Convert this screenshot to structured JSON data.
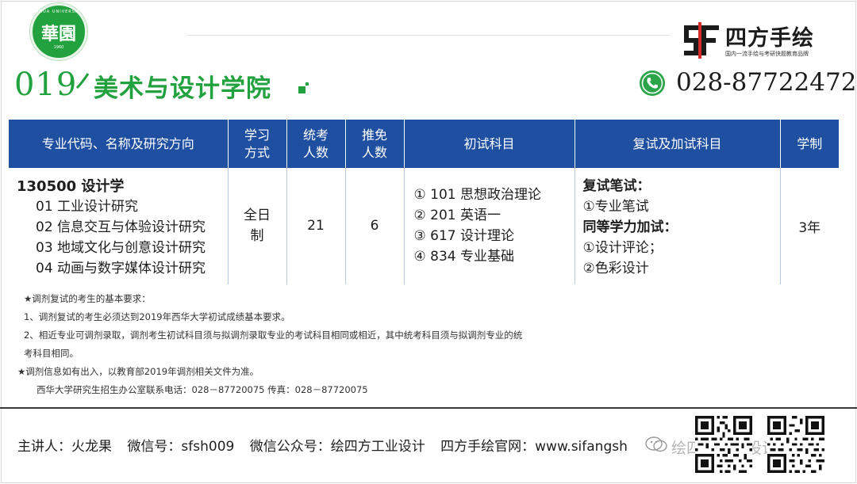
{
  "header": {
    "logo": {
      "main_text": "華園",
      "ring_text_top": "XIHUA UNIVERSITY",
      "ring_text_bottom": "1960"
    },
    "brand": {
      "name": "四方手绘",
      "slogan": "国内一流手绘与考研快题教育品牌",
      "mark_icon": "sf-logo-icon"
    },
    "school_code": "019",
    "school_name": "美术与设计学院",
    "phone_icon": "phone-icon",
    "phone": "028-87722472"
  },
  "table": {
    "headers": [
      "专业代码、名称及研究方向",
      "学习方式",
      "统考人数",
      "推免人数",
      "初试科目",
      "复试及加试科目",
      "学制"
    ],
    "headers_lines": [
      [
        "专业代码、名称及研究方向"
      ],
      [
        "学习",
        "方式"
      ],
      [
        "统考",
        "人数"
      ],
      [
        "推免",
        "人数"
      ],
      [
        "初试科目"
      ],
      [
        "复试及加试科目"
      ],
      [
        "学制"
      ]
    ],
    "row": {
      "major": "130500 设计学",
      "directions": [
        "01 工业设计研究",
        "02 信息交互与体验设计研究",
        "03 地域文化与创意设计研究",
        "04 动画与数字媒体设计研究"
      ],
      "study_mode_lines": [
        "全日",
        "制"
      ],
      "quota": "21",
      "recommended": "6",
      "exam_subjects": [
        "① 101 思想政治理论",
        "② 201 英语一",
        "③ 617 设计理论",
        "④ 834 专业基础"
      ],
      "retest": {
        "written_heading": "复试笔试：",
        "written_items": [
          "①专业笔试"
        ],
        "extra_heading": "同等学力加试：",
        "extra_items": [
          "①设计评论；",
          "②色彩设计"
        ]
      },
      "duration": "3年"
    }
  },
  "notes": [
    "★调剂复试的考生的基本要求：",
    "1、调剂复试的考生必须达到2019年西华大学初试成绩基本要求。",
    "2、相近专业可调剂录取，调剂考生初试科目须与拟调剂录取专业的考试科目相同或相近，其中统考科目须与拟调剂专业的统",
    "考科目相同。",
    "★调剂信息如有出入，以教育部2019年调剂相关文件为准。",
    "西华大学研究生招生办公室联系电话：028－87720075      传真：028－87720075"
  ],
  "footer": {
    "lecturer": "主讲人：火龙果",
    "wechat": "微信号：sfsh009",
    "official": "微信公众号：绘四方工业设计",
    "website": "四方手绘官网：www.sifangsh",
    "watermark": "绘四方工业设计",
    "wechat_icon": "wechat-icon",
    "qr_codes": [
      "qr-code-icon",
      "qr-code-icon"
    ]
  },
  "colors": {
    "green": "#22a23f",
    "table_header_blue": "#1f4fa1",
    "footer_rule": "#3a3a3a"
  }
}
